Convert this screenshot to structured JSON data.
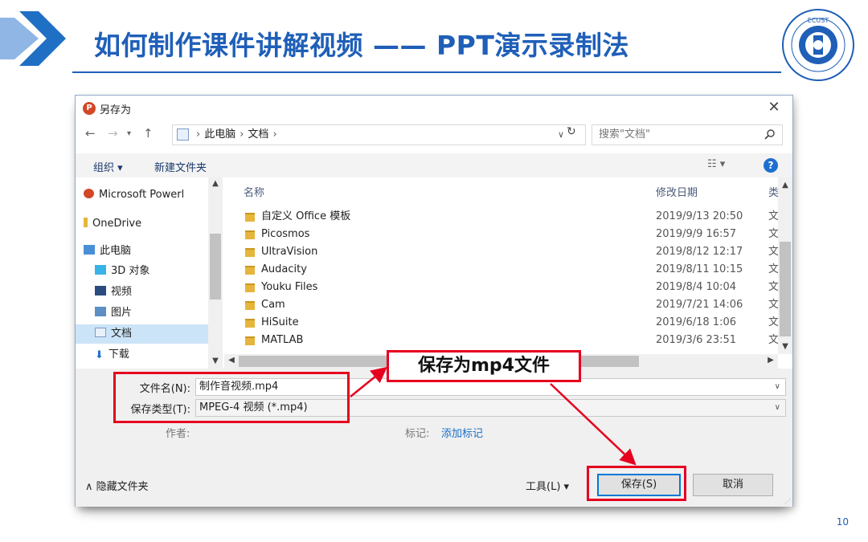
{
  "slide": {
    "title": "如何制作课件讲解视频 —— PPT演示录制法",
    "page_number": "10",
    "callout": "保存为mp4文件",
    "logo_text": "ECUST"
  },
  "dialog": {
    "title": "另存为",
    "breadcrumb": [
      "此电脑",
      "文档"
    ],
    "search_placeholder": "搜索\"文档\"",
    "toolbar": {
      "organize": "组织 ▾",
      "new_folder": "新建文件夹"
    },
    "nav_items": [
      {
        "label": "Microsoft Powerl",
        "icon": "powerpoint-icon"
      },
      {
        "label": "OneDrive",
        "icon": "folder-icon"
      },
      {
        "label": "此电脑",
        "icon": "computer-icon"
      },
      {
        "label": "3D 对象",
        "icon": "cube-icon"
      },
      {
        "label": "视频",
        "icon": "video-icon"
      },
      {
        "label": "图片",
        "icon": "picture-icon"
      },
      {
        "label": "文档",
        "icon": "document-icon"
      },
      {
        "label": "下载",
        "icon": "download-icon"
      }
    ],
    "columns": {
      "name": "名称",
      "date": "修改日期",
      "type": "类"
    },
    "files": [
      {
        "name": "自定义 Office 模板",
        "date": "2019/9/13 20:50",
        "type": "文"
      },
      {
        "name": "Picosmos",
        "date": "2019/9/9 16:57",
        "type": "文"
      },
      {
        "name": "UltraVision",
        "date": "2019/8/12 12:17",
        "type": "文"
      },
      {
        "name": "Audacity",
        "date": "2019/8/11 10:15",
        "type": "文"
      },
      {
        "name": "Youku Files",
        "date": "2019/8/4 10:04",
        "type": "文"
      },
      {
        "name": "Cam",
        "date": "2019/7/21 14:06",
        "type": "文"
      },
      {
        "name": "HiSuite",
        "date": "2019/6/18 1:06",
        "type": "文"
      },
      {
        "name": "MATLAB",
        "date": "2019/3/6 23:51",
        "type": "文"
      }
    ],
    "filename_label": "文件名(N):",
    "filename_value": "制作音视频.mp4",
    "filetype_label": "保存类型(T):",
    "filetype_value": "MPEG-4 视频 (*.mp4)",
    "author_label": "作者:",
    "tags_label": "标记:",
    "tags_link": "添加标记",
    "hide_folders": "∧ 隐藏文件夹",
    "tools": "工具(L) ▾",
    "save": "保存(S)",
    "cancel": "取消"
  },
  "colors": {
    "title_blue": "#1f5fb8",
    "annotation_red": "#e6001f",
    "selection": "#cce4f7"
  }
}
